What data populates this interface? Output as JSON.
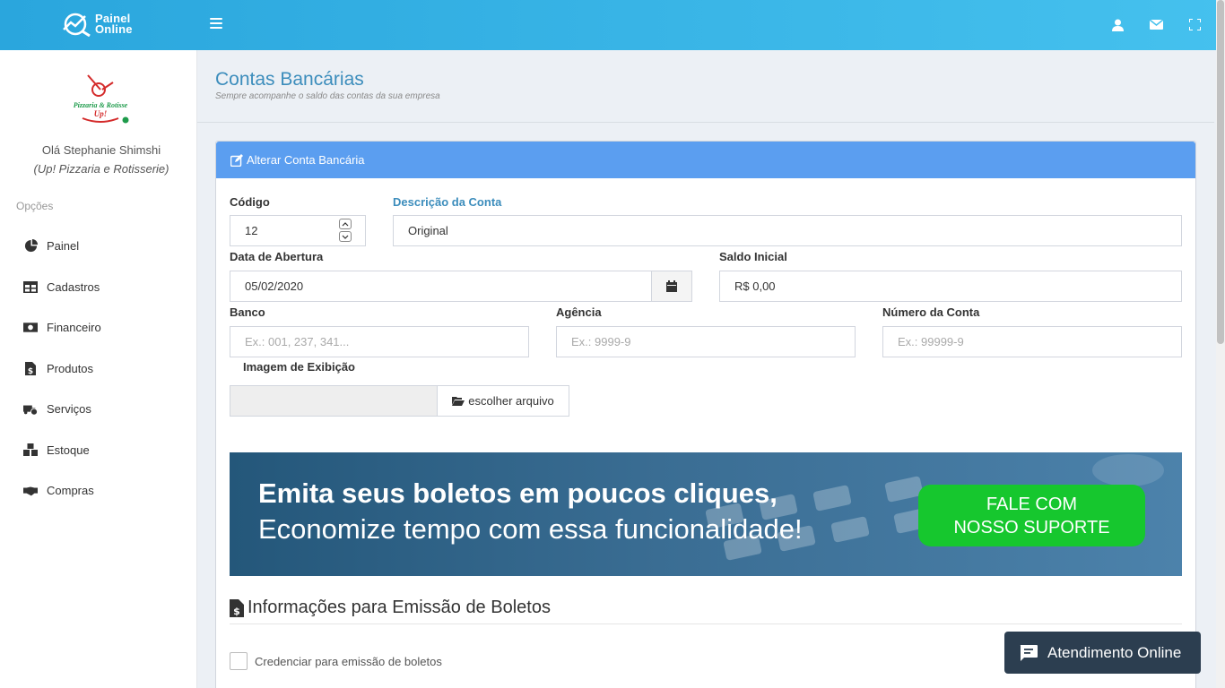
{
  "brand": {
    "line1": "Painel",
    "line2": "Online"
  },
  "header": {
    "menu_toggle": "menu",
    "icons": [
      "user-icon",
      "envelope-icon",
      "fullscreen-icon"
    ]
  },
  "sidebar": {
    "greeting": "Olá Stephanie Shimshi",
    "company": "(Up! Pizzaria e Rotisserie)",
    "company_logo_text": {
      "top": "Pizzaria & Rotisse",
      "bottom": "Up!"
    },
    "options_label": "Opções",
    "items": [
      {
        "label": "Painel",
        "icon": "pie-chart-icon"
      },
      {
        "label": "Cadastros",
        "icon": "table-icon"
      },
      {
        "label": "Financeiro",
        "icon": "money-icon"
      },
      {
        "label": "Produtos",
        "icon": "file-dollar-icon"
      },
      {
        "label": "Serviços",
        "icon": "truck-clock-icon"
      },
      {
        "label": "Estoque",
        "icon": "boxes-icon"
      },
      {
        "label": "Compras",
        "icon": "handshake-icon"
      }
    ]
  },
  "page": {
    "title": "Contas Bancárias",
    "subtitle": "Sempre acompanhe o saldo das contas da sua empresa"
  },
  "panel": {
    "heading": "Alterar Conta Bancária"
  },
  "form": {
    "codigo": {
      "label": "Código",
      "value": "12"
    },
    "descricao": {
      "label": "Descrição da Conta",
      "value": "Original"
    },
    "data_abertura": {
      "label": "Data de Abertura",
      "value": "05/02/2020"
    },
    "saldo_inicial": {
      "label": "Saldo Inicial",
      "value": "R$ 0,00"
    },
    "banco": {
      "label": "Banco",
      "placeholder": "Ex.: 001, 237, 341..."
    },
    "agencia": {
      "label": "Agência",
      "placeholder": "Ex.: 9999-9"
    },
    "numero_conta": {
      "label": "Número da Conta",
      "placeholder": "Ex.: 99999-9"
    },
    "imagem": {
      "label": "Imagem de Exibição",
      "button": "escolher arquivo"
    }
  },
  "banner": {
    "line1": "Emita seus boletos em poucos cliques,",
    "line2": "Economize tempo com essa funcionalidade!",
    "cta_line1": "FALE COM",
    "cta_line2": "NOSSO SUPORTE"
  },
  "boletos": {
    "title": "Informações para Emissão de Boletos",
    "checkbox_label": "Credenciar para emissão de boletos"
  },
  "chat": {
    "label": "Atendimento Online"
  },
  "colors": {
    "topbar": "#2aa6dd",
    "panel_heading": "#5b9ef0",
    "title": "#3c8dbc",
    "cta": "#16c72e",
    "chat": "#2c3e50"
  }
}
